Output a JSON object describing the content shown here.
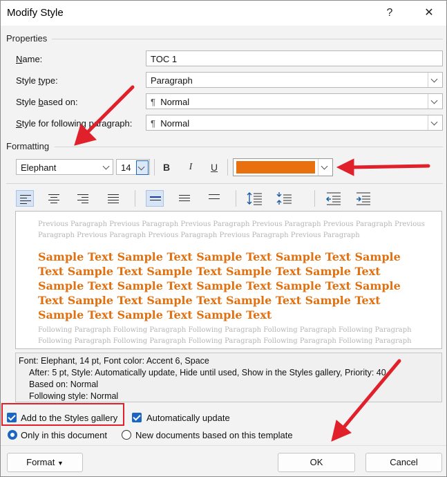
{
  "window": {
    "title": "Modify Style",
    "help_glyph": "?",
    "close_glyph": "✕"
  },
  "properties": {
    "section_label": "Properties",
    "name_label": "Name:",
    "name_value": "TOC 1",
    "style_type_label": "Style type:",
    "style_type_value": "Paragraph",
    "based_on_label": "Style based on:",
    "based_on_value": "Normal",
    "following_label": "Style for following paragraph:",
    "following_value": "Normal",
    "pilcrow": "¶"
  },
  "formatting": {
    "section_label": "Formatting",
    "font": "Elephant",
    "size": "14",
    "bold": "B",
    "italic": "I",
    "underline": "U",
    "font_color": "#e8700e"
  },
  "preview": {
    "previous_1": "Previous Paragraph Previous Paragraph Previous Paragraph Previous Paragraph Previous Paragraph Previous",
    "previous_2": "Paragraph Previous Paragraph Previous Paragraph Previous Paragraph Previous Paragraph",
    "sample": "Sample Text Sample Text Sample Text Sample Text Sample Text Sample Text Sample Text Sample Text Sample Text Sample Text Sample Text Sample Text Sample Text Sample Text Sample Text Sample Text Sample Text Sample Text Sample Text Sample Text Sample Text",
    "following_1": "Following Paragraph Following Paragraph Following Paragraph Following Paragraph Following Paragraph",
    "following_2": "Following Paragraph Following Paragraph Following Paragraph Following Paragraph Following Paragraph"
  },
  "description": {
    "line1": "Font: Elephant, 14 pt, Font color: Accent 6, Space",
    "line2": "After:  5 pt, Style: Automatically update, Hide until used, Show in the Styles gallery, Priority: 40",
    "line3": "Based on: Normal",
    "line4": "Following style: Normal"
  },
  "options": {
    "add_to_gallery": "Add to the Styles gallery",
    "add_to_gallery_checked": true,
    "auto_update": "Automatically update",
    "auto_update_checked": true,
    "only_this_doc": "Only in this document",
    "new_docs": "New documents based on this template",
    "selected_scope": "only_this_doc"
  },
  "buttons": {
    "format": "Format",
    "ok": "OK",
    "cancel": "Cancel"
  },
  "colors": {
    "accent": "#1a66c2",
    "annotation_red": "#e0202a",
    "sample_text": "#e07010"
  }
}
